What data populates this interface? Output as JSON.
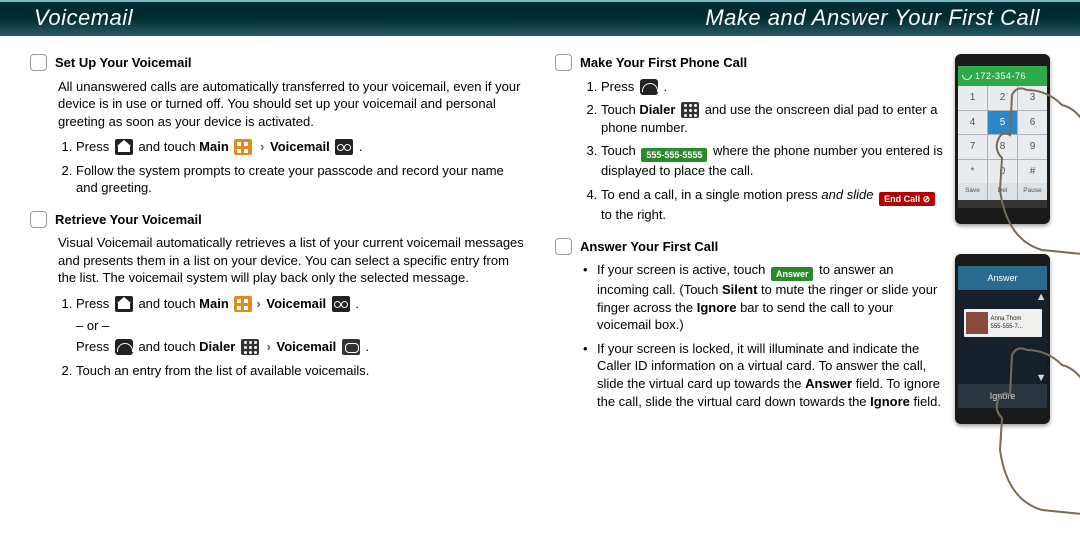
{
  "header": {
    "left": "Voicemail",
    "right": "Make and Answer Your First Call"
  },
  "left": {
    "setup": {
      "heading": "Set Up Your Voicemail",
      "intro": "All unanswered calls are automatically transferred to your voicemail, even if your device is in use or turned off. You should set up your voicemail and personal greeting as soon as your device is activated.",
      "step1_a": "Press ",
      "step1_b": " and touch ",
      "step1_main": "Main",
      "step1_vm": "Voicemail",
      "step1_end": " .",
      "step2": "Follow the system prompts to create your passcode and record your name and greeting."
    },
    "retrieve": {
      "heading": "Retrieve Your Voicemail",
      "intro": "Visual Voicemail automatically retrieves a list of your current voicemail messages and presents them in a list on your device. You can select a specific entry from the list. The voicemail system will play back only the selected message.",
      "s1a": "Press ",
      "s1b": " and touch ",
      "s1_main": "Main",
      "s1_vm": "Voicemail",
      "s1_end": " .",
      "or": "– or –",
      "s1c": "Press ",
      "s1d": " and touch ",
      "s1_dialer": "Dialer",
      "s1_vm2": "Voicemail",
      "s1_end2": " .",
      "s2": "Touch an entry from the list of available voicemails."
    }
  },
  "right": {
    "make": {
      "heading": "Make Your First Phone Call",
      "s1": "Press ",
      "s1_end": " .",
      "s2a": "Touch ",
      "s2_dialer": "Dialer",
      "s2b": " and use the onscreen dial pad to enter a phone number.",
      "s3a": "Touch ",
      "s3_pill": "555-555-5555",
      "s3b": " where the phone number you entered is displayed to place the call.",
      "s4a": "To end a call, in a single motion press ",
      "s4_em": "and slide",
      "s4_pill": "End Call ⊘",
      "s4b": " to the right."
    },
    "answer": {
      "heading": "Answer Your First Call",
      "b1a": "If your screen is active, touch ",
      "b1_pill": "Answer",
      "b1b": " to answer an incoming call. (Touch ",
      "b1_silent": "Silent",
      "b1c": " to mute the ringer or slide your finger across the ",
      "b1_ignore": "Ignore",
      "b1d": " bar to send the call to your voicemail box.)",
      "b2a": "If your screen is locked, it will illuminate and indicate the Caller ID information on a virtual card. To answer the call, slide the virtual card up towards the ",
      "b2_answer": "Answer",
      "b2b": " field. To ignore the call, slide the virtual card down towards the ",
      "b2_ignore": "Ignore",
      "b2c": " field."
    }
  },
  "phone1": {
    "dialed": "172-354-76",
    "keys": [
      "1",
      "2",
      "3",
      "4",
      "5",
      "6",
      "7",
      "8",
      "9",
      "*",
      "0",
      "#"
    ],
    "row3": [
      "Save",
      "Del",
      "Pause"
    ],
    "active_key_index": 4
  },
  "phone2": {
    "answer": "Answer",
    "ignore": "Ignore",
    "caller_name": "Anna Thom",
    "caller_num": "555-555-7..."
  }
}
